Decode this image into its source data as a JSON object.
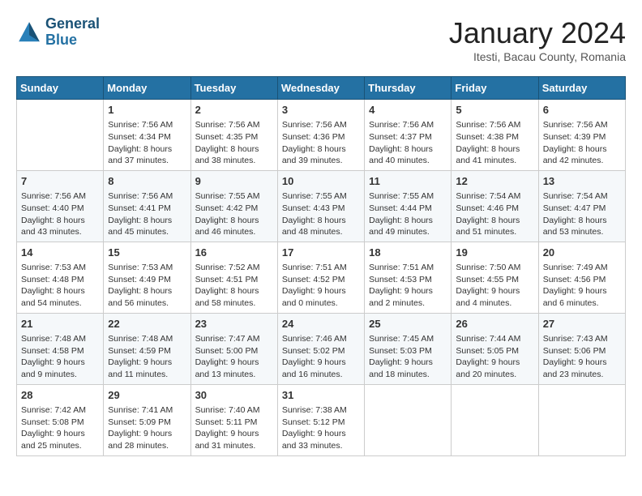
{
  "header": {
    "logo_line1": "General",
    "logo_line2": "Blue",
    "month": "January 2024",
    "location": "Itesti, Bacau County, Romania"
  },
  "days_of_week": [
    "Sunday",
    "Monday",
    "Tuesday",
    "Wednesday",
    "Thursday",
    "Friday",
    "Saturday"
  ],
  "weeks": [
    [
      {
        "day": "",
        "info": ""
      },
      {
        "day": "1",
        "info": "Sunrise: 7:56 AM\nSunset: 4:34 PM\nDaylight: 8 hours\nand 37 minutes."
      },
      {
        "day": "2",
        "info": "Sunrise: 7:56 AM\nSunset: 4:35 PM\nDaylight: 8 hours\nand 38 minutes."
      },
      {
        "day": "3",
        "info": "Sunrise: 7:56 AM\nSunset: 4:36 PM\nDaylight: 8 hours\nand 39 minutes."
      },
      {
        "day": "4",
        "info": "Sunrise: 7:56 AM\nSunset: 4:37 PM\nDaylight: 8 hours\nand 40 minutes."
      },
      {
        "day": "5",
        "info": "Sunrise: 7:56 AM\nSunset: 4:38 PM\nDaylight: 8 hours\nand 41 minutes."
      },
      {
        "day": "6",
        "info": "Sunrise: 7:56 AM\nSunset: 4:39 PM\nDaylight: 8 hours\nand 42 minutes."
      }
    ],
    [
      {
        "day": "7",
        "info": "Sunrise: 7:56 AM\nSunset: 4:40 PM\nDaylight: 8 hours\nand 43 minutes."
      },
      {
        "day": "8",
        "info": "Sunrise: 7:56 AM\nSunset: 4:41 PM\nDaylight: 8 hours\nand 45 minutes."
      },
      {
        "day": "9",
        "info": "Sunrise: 7:55 AM\nSunset: 4:42 PM\nDaylight: 8 hours\nand 46 minutes."
      },
      {
        "day": "10",
        "info": "Sunrise: 7:55 AM\nSunset: 4:43 PM\nDaylight: 8 hours\nand 48 minutes."
      },
      {
        "day": "11",
        "info": "Sunrise: 7:55 AM\nSunset: 4:44 PM\nDaylight: 8 hours\nand 49 minutes."
      },
      {
        "day": "12",
        "info": "Sunrise: 7:54 AM\nSunset: 4:46 PM\nDaylight: 8 hours\nand 51 minutes."
      },
      {
        "day": "13",
        "info": "Sunrise: 7:54 AM\nSunset: 4:47 PM\nDaylight: 8 hours\nand 53 minutes."
      }
    ],
    [
      {
        "day": "14",
        "info": "Sunrise: 7:53 AM\nSunset: 4:48 PM\nDaylight: 8 hours\nand 54 minutes."
      },
      {
        "day": "15",
        "info": "Sunrise: 7:53 AM\nSunset: 4:49 PM\nDaylight: 8 hours\nand 56 minutes."
      },
      {
        "day": "16",
        "info": "Sunrise: 7:52 AM\nSunset: 4:51 PM\nDaylight: 8 hours\nand 58 minutes."
      },
      {
        "day": "17",
        "info": "Sunrise: 7:51 AM\nSunset: 4:52 PM\nDaylight: 9 hours\nand 0 minutes."
      },
      {
        "day": "18",
        "info": "Sunrise: 7:51 AM\nSunset: 4:53 PM\nDaylight: 9 hours\nand 2 minutes."
      },
      {
        "day": "19",
        "info": "Sunrise: 7:50 AM\nSunset: 4:55 PM\nDaylight: 9 hours\nand 4 minutes."
      },
      {
        "day": "20",
        "info": "Sunrise: 7:49 AM\nSunset: 4:56 PM\nDaylight: 9 hours\nand 6 minutes."
      }
    ],
    [
      {
        "day": "21",
        "info": "Sunrise: 7:48 AM\nSunset: 4:58 PM\nDaylight: 9 hours\nand 9 minutes."
      },
      {
        "day": "22",
        "info": "Sunrise: 7:48 AM\nSunset: 4:59 PM\nDaylight: 9 hours\nand 11 minutes."
      },
      {
        "day": "23",
        "info": "Sunrise: 7:47 AM\nSunset: 5:00 PM\nDaylight: 9 hours\nand 13 minutes."
      },
      {
        "day": "24",
        "info": "Sunrise: 7:46 AM\nSunset: 5:02 PM\nDaylight: 9 hours\nand 16 minutes."
      },
      {
        "day": "25",
        "info": "Sunrise: 7:45 AM\nSunset: 5:03 PM\nDaylight: 9 hours\nand 18 minutes."
      },
      {
        "day": "26",
        "info": "Sunrise: 7:44 AM\nSunset: 5:05 PM\nDaylight: 9 hours\nand 20 minutes."
      },
      {
        "day": "27",
        "info": "Sunrise: 7:43 AM\nSunset: 5:06 PM\nDaylight: 9 hours\nand 23 minutes."
      }
    ],
    [
      {
        "day": "28",
        "info": "Sunrise: 7:42 AM\nSunset: 5:08 PM\nDaylight: 9 hours\nand 25 minutes."
      },
      {
        "day": "29",
        "info": "Sunrise: 7:41 AM\nSunset: 5:09 PM\nDaylight: 9 hours\nand 28 minutes."
      },
      {
        "day": "30",
        "info": "Sunrise: 7:40 AM\nSunset: 5:11 PM\nDaylight: 9 hours\nand 31 minutes."
      },
      {
        "day": "31",
        "info": "Sunrise: 7:38 AM\nSunset: 5:12 PM\nDaylight: 9 hours\nand 33 minutes."
      },
      {
        "day": "",
        "info": ""
      },
      {
        "day": "",
        "info": ""
      },
      {
        "day": "",
        "info": ""
      }
    ]
  ]
}
